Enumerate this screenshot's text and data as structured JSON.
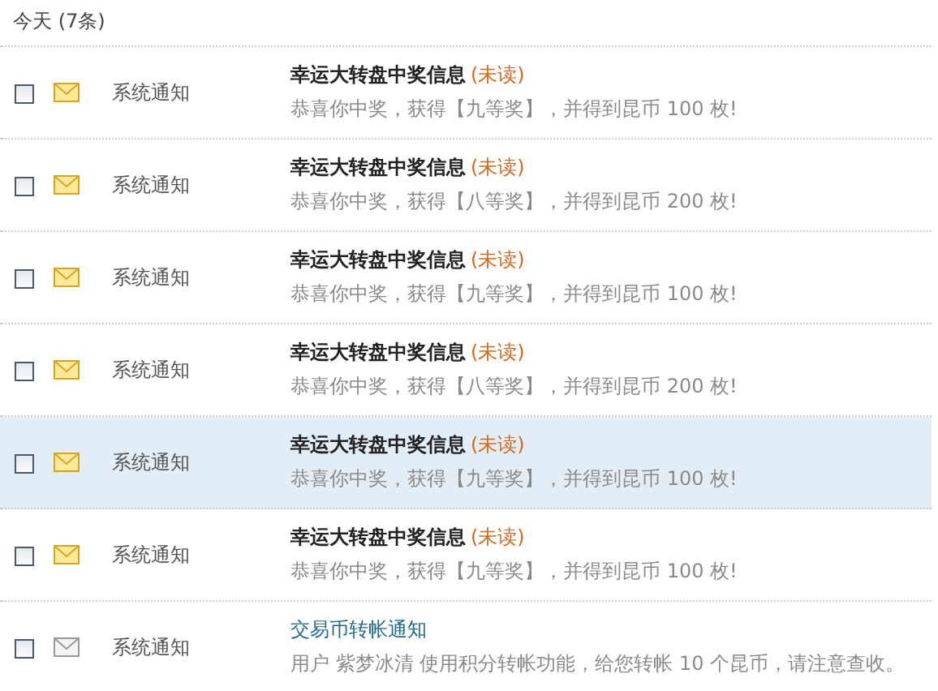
{
  "header": "今天 (7条)",
  "messages": [
    {
      "checked": false,
      "read": false,
      "highlighted": false,
      "sender": "系统通知",
      "title": "幸运大转盘中奖信息",
      "unread_tag": "(未读)",
      "body": "恭喜你中奖，获得【九等奖】，并得到昆币 100 枚!"
    },
    {
      "checked": false,
      "read": false,
      "highlighted": false,
      "sender": "系统通知",
      "title": "幸运大转盘中奖信息",
      "unread_tag": "(未读)",
      "body": "恭喜你中奖，获得【八等奖】，并得到昆币 200 枚!"
    },
    {
      "checked": false,
      "read": false,
      "highlighted": false,
      "sender": "系统通知",
      "title": "幸运大转盘中奖信息",
      "unread_tag": "(未读)",
      "body": "恭喜你中奖，获得【九等奖】，并得到昆币 100 枚!"
    },
    {
      "checked": false,
      "read": false,
      "highlighted": false,
      "sender": "系统通知",
      "title": "幸运大转盘中奖信息",
      "unread_tag": "(未读)",
      "body": "恭喜你中奖，获得【八等奖】，并得到昆币 200 枚!"
    },
    {
      "checked": false,
      "read": false,
      "highlighted": true,
      "sender": "系统通知",
      "title": "幸运大转盘中奖信息",
      "unread_tag": "(未读)",
      "body": "恭喜你中奖，获得【九等奖】，并得到昆币 100 枚!"
    },
    {
      "checked": false,
      "read": false,
      "highlighted": false,
      "sender": "系统通知",
      "title": "幸运大转盘中奖信息",
      "unread_tag": "(未读)",
      "body": "恭喜你中奖，获得【九等奖】，并得到昆币 100 枚!"
    },
    {
      "checked": false,
      "read": true,
      "highlighted": false,
      "sender": "系统通知",
      "title": "交易币转帐通知",
      "body": "用户 紫梦冰清 使用积分转帐功能，给您转帐 10 个昆币，请注意查收。"
    }
  ]
}
